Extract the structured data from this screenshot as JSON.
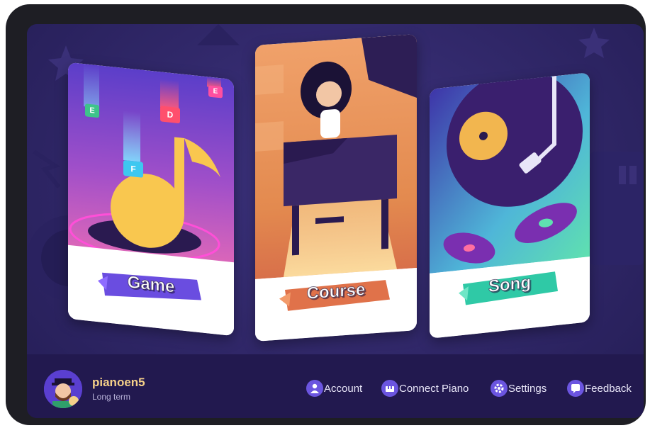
{
  "cards": [
    {
      "id": "game",
      "label": "Game",
      "note_keys": [
        "E",
        "D",
        "F",
        "E"
      ]
    },
    {
      "id": "course",
      "label": "Course"
    },
    {
      "id": "song",
      "label": "Song"
    }
  ],
  "user": {
    "name": "pianoen5",
    "plan": "Long term"
  },
  "menu": {
    "account": "Account",
    "connect_piano": "Connect Piano",
    "settings": "Settings",
    "feedback": "Feedback"
  },
  "colors": {
    "screen_bg": "#302768",
    "bottom_bar": "#22194f",
    "username": "#f5d089",
    "icon_bg": "#6b55e0",
    "game_banner": "#6a4de0",
    "course_banner": "#e0724a",
    "song_banner": "#2fc9a6"
  },
  "icons": [
    "avatar",
    "account-icon",
    "connect-piano-icon",
    "settings-icon",
    "feedback-icon",
    "music-note-icon",
    "piano-icon",
    "vinyl-record-icon"
  ]
}
